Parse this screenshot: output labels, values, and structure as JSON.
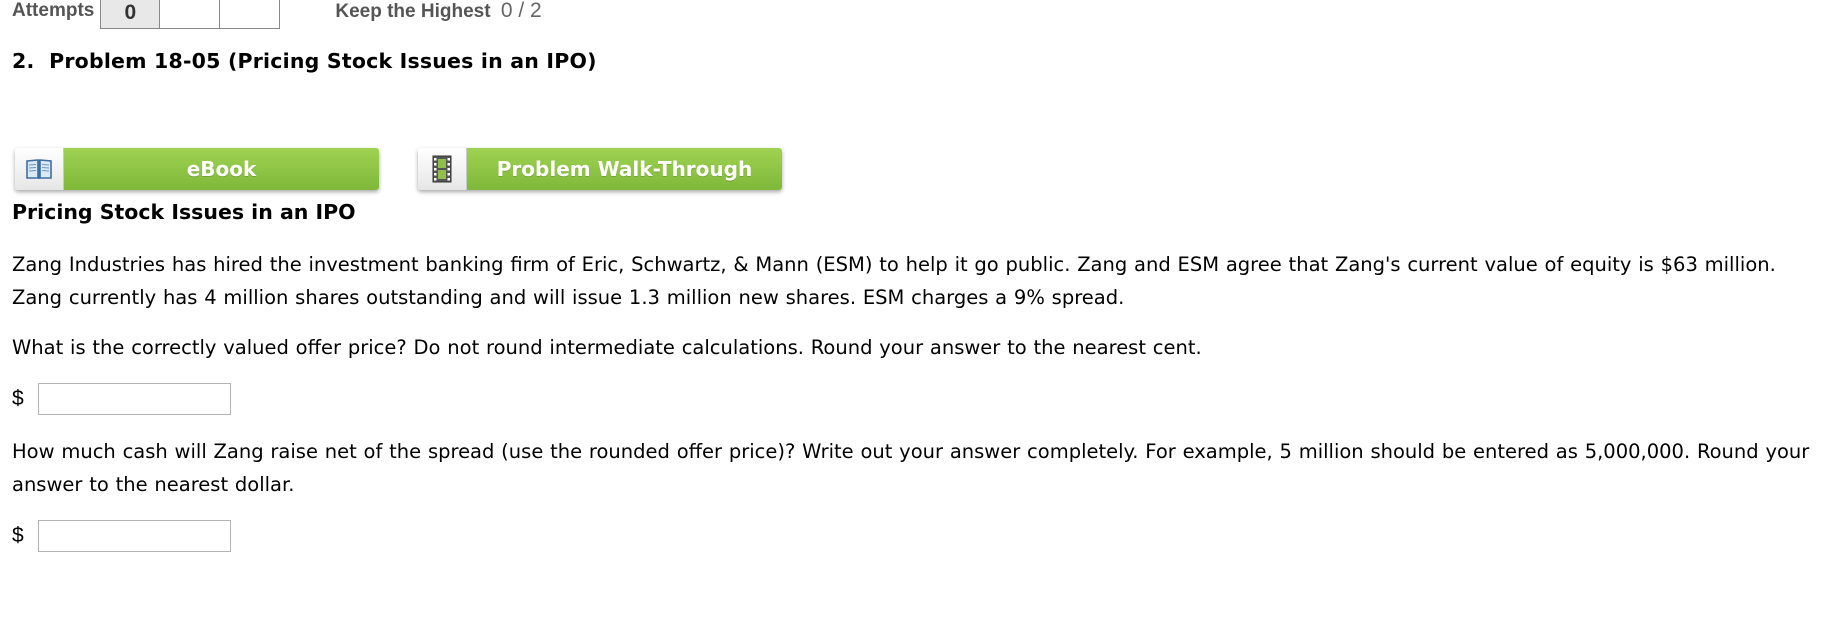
{
  "attempts": {
    "label": "Attempts",
    "boxes": [
      "0",
      "",
      ""
    ]
  },
  "keep_highest": {
    "label": "Keep the Highest",
    "score": "0 / 2"
  },
  "problem": {
    "title": "2.  Problem 18-05 (Pricing Stock Issues in an IPO)"
  },
  "buttons": {
    "ebook": {
      "label": "eBook",
      "icon": "book-icon"
    },
    "walkthrough": {
      "label": "Problem Walk-Through",
      "icon": "film-icon"
    }
  },
  "content": {
    "heading": "Pricing Stock Issues in an IPO",
    "intro": "Zang Industries has hired the investment banking firm of Eric, Schwartz, & Mann (ESM) to help it go public. Zang and ESM agree that Zang's current value of equity is $63 million. Zang currently has 4 million shares outstanding and will issue 1.3 million new shares. ESM charges a 9% spread.",
    "question1": "What is the correctly valued offer price? Do not round intermediate calculations. Round your answer to the nearest cent.",
    "question2": "How much cash will Zang raise net of the spread (use the rounded offer price)? Write out your answer completely. For example, 5 million should be entered as 5,000,000. Round your answer to the nearest dollar.",
    "answer1": {
      "prefix": "$",
      "value": ""
    },
    "answer2": {
      "prefix": "$",
      "value": ""
    }
  },
  "colors": {
    "button_green": "#8cc43f",
    "text": "#000000",
    "label_gray": "#555555"
  }
}
